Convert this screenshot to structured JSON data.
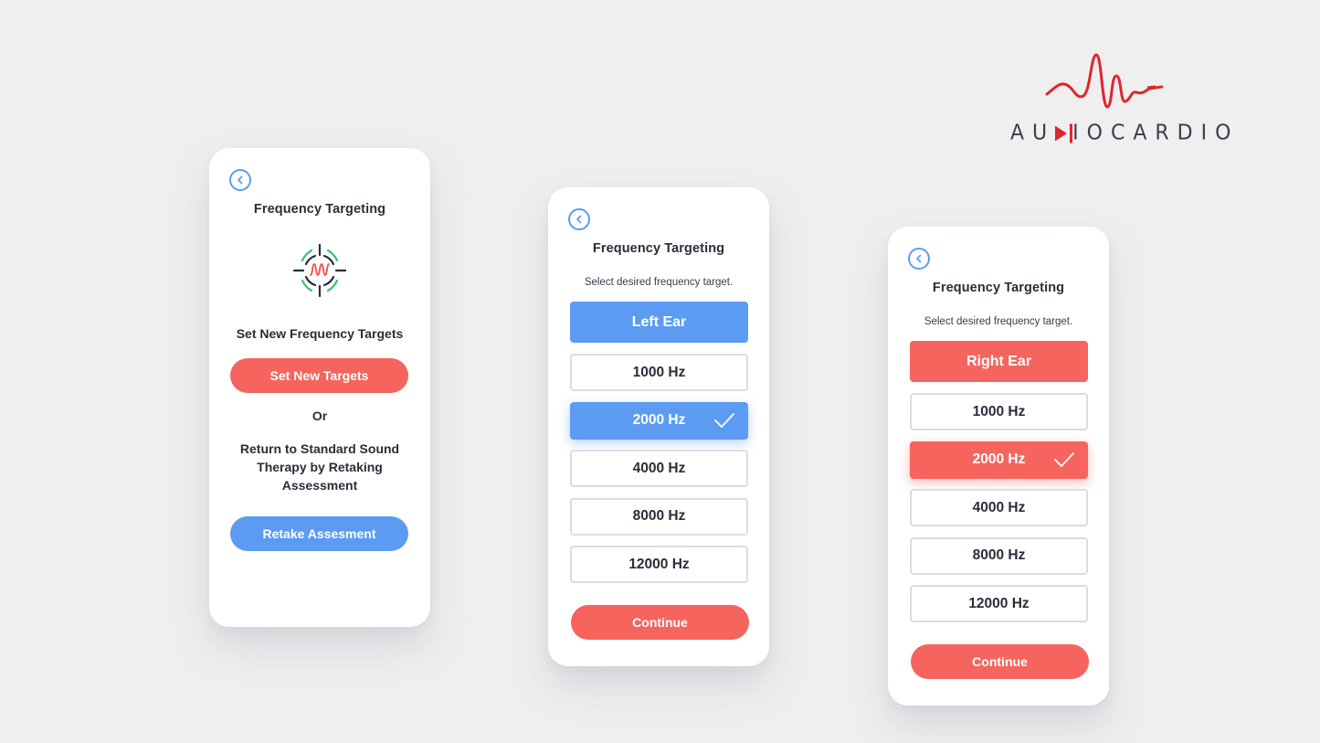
{
  "brand": {
    "name_parts": [
      "AU",
      "IOCARDIO"
    ],
    "full_name": "AUDIOCARDIO",
    "logo_icon": "sound-wave-audio-jack-icon",
    "accent_color": "#e0262b"
  },
  "colors": {
    "blue": "#5b9cf2",
    "red": "#f5655d",
    "background": "#efeff0",
    "text": "#2a2d3a"
  },
  "screens": [
    {
      "id": "set-targets",
      "back_icon": "chevron-left-circle-icon",
      "title": "Frequency Targeting",
      "illustration_icon": "frequency-target-crosshair-icon",
      "heading": "Set New Frequency Targets",
      "primary_button": "Set New Targets",
      "or_label": "Or",
      "description": "Return to Standard Sound Therapy by Retaking Assessment",
      "secondary_button": "Retake Assesment"
    },
    {
      "id": "left-ear",
      "back_icon": "chevron-left-circle-icon",
      "title": "Frequency Targeting",
      "subtitle": "Select desired frequency target.",
      "ear_label": "Left Ear",
      "options": [
        {
          "label": "1000 Hz",
          "selected": false
        },
        {
          "label": "2000 Hz",
          "selected": true
        },
        {
          "label": "4000 Hz",
          "selected": false
        },
        {
          "label": "8000 Hz",
          "selected": false
        },
        {
          "label": "12000 Hz",
          "selected": false
        }
      ],
      "continue_label": "Continue"
    },
    {
      "id": "right-ear",
      "back_icon": "chevron-left-circle-icon",
      "title": "Frequency Targeting",
      "subtitle": "Select desired frequency target.",
      "ear_label": "Right Ear",
      "options": [
        {
          "label": "1000 Hz",
          "selected": false
        },
        {
          "label": "2000 Hz",
          "selected": true
        },
        {
          "label": "4000 Hz",
          "selected": false
        },
        {
          "label": "8000 Hz",
          "selected": false
        },
        {
          "label": "12000 Hz",
          "selected": false
        }
      ],
      "continue_label": "Continue"
    }
  ]
}
